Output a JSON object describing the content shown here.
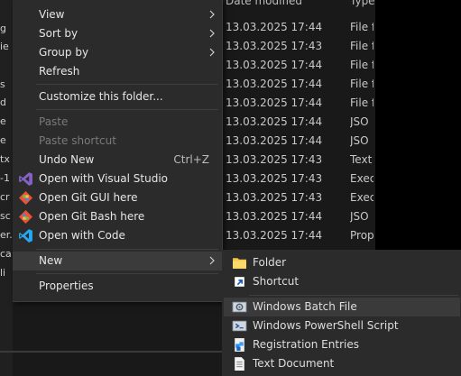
{
  "background": {
    "left_names": [
      "g",
      "ie",
      "s",
      "d",
      "e",
      "e",
      "tx",
      "-1",
      "cr",
      "sc",
      "er.",
      "ca",
      "li"
    ],
    "list_header": {
      "date": "Date modified",
      "type": "Type"
    },
    "rows": [
      {
        "date": "13.03.2025 17:44",
        "type": "File f"
      },
      {
        "date": "13.03.2025 17:43",
        "type": "File f"
      },
      {
        "date": "13.03.2025 17:44",
        "type": "File f"
      },
      {
        "date": "13.03.2025 17:44",
        "type": "File f"
      },
      {
        "date": "13.03.2025 17:44",
        "type": "File f"
      },
      {
        "date": "13.03.2025 17:44",
        "type": "JSO"
      },
      {
        "date": "13.03.2025 17:44",
        "type": "JSO"
      },
      {
        "date": "13.03.2025 17:43",
        "type": "Text"
      },
      {
        "date": "13.03.2025 17:43",
        "type": "Exec"
      },
      {
        "date": "13.03.2025 17:43",
        "type": "Exec"
      },
      {
        "date": "13.03.2025 17:44",
        "type": "JSO"
      },
      {
        "date": "13.03.2025 17:44",
        "type": "Prop"
      }
    ]
  },
  "menu": {
    "view": "View",
    "sort_by": "Sort by",
    "group_by": "Group by",
    "refresh": "Refresh",
    "customize": "Customize this folder...",
    "paste": "Paste",
    "paste_shortcut": "Paste shortcut",
    "undo_new": "Undo New",
    "undo_shortcut": "Ctrl+Z",
    "open_vs": "Open with Visual Studio",
    "open_git_gui": "Open Git GUI here",
    "open_git_bash": "Open Git Bash here",
    "open_code": "Open with Code",
    "new": "New",
    "properties": "Properties"
  },
  "submenu": {
    "folder": "Folder",
    "shortcut": "Shortcut",
    "batch": "Windows Batch File",
    "powershell": "Windows PowerShell Script",
    "registration": "Registration Entries",
    "text_doc": "Text Document"
  },
  "colors": {
    "menu_bg": "#2b2b2b",
    "vs_purple": "#8661c5",
    "git_orange": "#f05033",
    "vscode_blue": "#23a9f2",
    "folder_yellow": "#f4c84a"
  }
}
